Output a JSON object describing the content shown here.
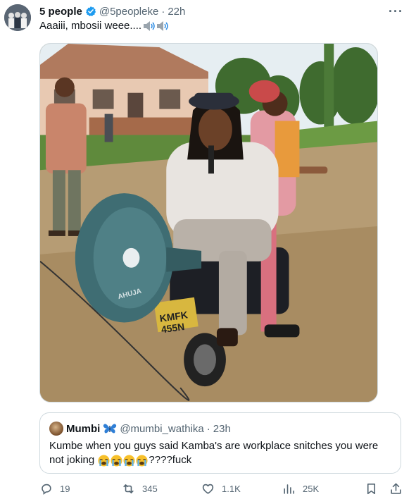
{
  "tweet": {
    "display_name": "5 people",
    "handle": "@5peopleke",
    "separator": "·",
    "time": "22h",
    "more_icon": "more-horizontal-icon",
    "text": "Aaaiii, mbosii weee....",
    "speaker_icon": "speaker-emoji"
  },
  "quote": {
    "display_name": "Mumbi",
    "name_emoji": "butterfly-emoji",
    "handle": "@mumbi_wathika",
    "separator": "·",
    "time": "23h",
    "text_line1": "Kumbe when you guys said Kamba's are workplace snitches you were",
    "text_pre": "not joking",
    "text_post": "????fuck",
    "emoji_icon": "loudly-crying-face-emoji",
    "emoji_count": 4
  },
  "actions": {
    "reply_count": "19",
    "retweet_count": "345",
    "like_count": "1.1K",
    "views_count": "25K"
  },
  "colors": {
    "verified_blue": "#1d9bf0",
    "secondary_text": "#536471",
    "border": "#cfd9de"
  }
}
